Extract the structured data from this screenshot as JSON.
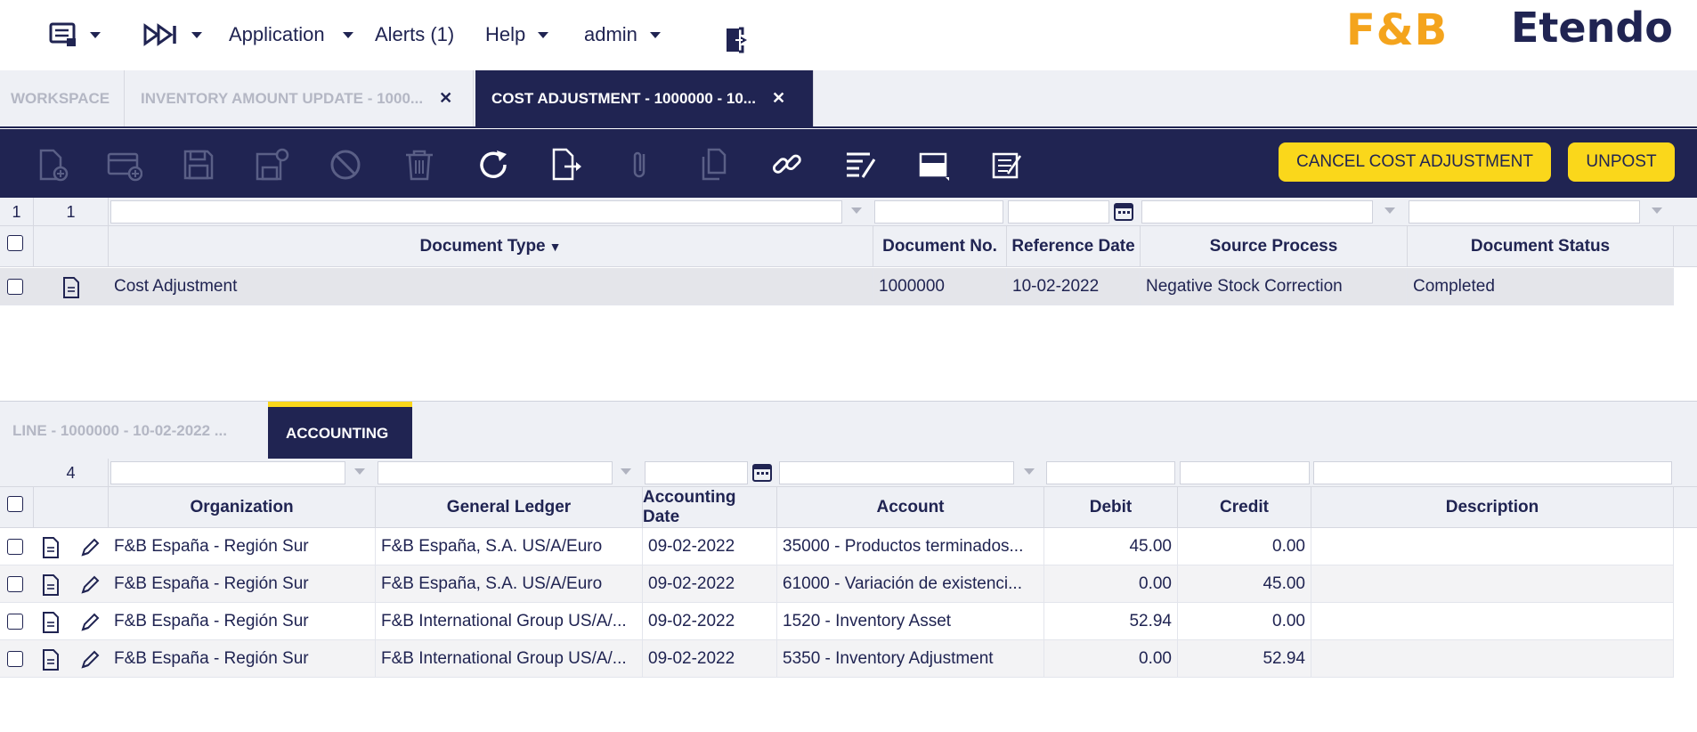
{
  "topbar": {
    "nav": {
      "application": "Application",
      "alerts": "Alerts (1)",
      "help": "Help",
      "user": "admin"
    },
    "brand_logo": "F&B",
    "brand_name": "Etendo"
  },
  "window_tabs": [
    {
      "label": "WORKSPACE"
    },
    {
      "label": "INVENTORY AMOUNT UPDATE - 1000..."
    },
    {
      "label": "COST ADJUSTMENT - 1000000 - 10..."
    }
  ],
  "toolbar": {
    "cancel_label": "CANCEL COST ADJUSTMENT",
    "unpost_label": "UNPOST",
    "icons": [
      "new-document-icon",
      "new-row-icon",
      "save-icon",
      "save-close-icon",
      "undo-icon",
      "delete-icon",
      "refresh-icon",
      "export-icon",
      "attachment-icon",
      "clone-icon",
      "link-icon",
      "audit-icon",
      "grid-view-icon",
      "notes-icon"
    ]
  },
  "header_grid": {
    "selected_count": "1",
    "total_count": "1",
    "columns": [
      "Document Type",
      "Document No.",
      "Reference Date",
      "Source Process",
      "Document Status"
    ],
    "rows": [
      {
        "document_type": "Cost Adjustment",
        "document_no": "1000000",
        "reference_date": "10-02-2022",
        "source_process": "Negative Stock Correction",
        "document_status": "Completed"
      }
    ]
  },
  "child_tabs": [
    {
      "label": "LINE - 1000000 - 10-02-2022 ..."
    },
    {
      "label": "ACCOUNTING"
    }
  ],
  "accounting_grid": {
    "total_count": "4",
    "columns": [
      "Organization",
      "General Ledger",
      "Accounting Date",
      "Account",
      "Debit",
      "Credit",
      "Description"
    ],
    "rows": [
      {
        "organization": "F&B España - Región Sur",
        "ledger": "F&B España, S.A. US/A/Euro",
        "date": "09-02-2022",
        "account": "35000 - Productos terminados...",
        "debit": "45.00",
        "credit": "0.00",
        "description": ""
      },
      {
        "organization": "F&B España - Región Sur",
        "ledger": "F&B España, S.A. US/A/Euro",
        "date": "09-02-2022",
        "account": "61000 - Variación de existenci...",
        "debit": "0.00",
        "credit": "45.00",
        "description": ""
      },
      {
        "organization": "F&B España - Región Sur",
        "ledger": "F&B International Group US/A/...",
        "date": "09-02-2022",
        "account": "1520 - Inventory Asset",
        "debit": "52.94",
        "credit": "0.00",
        "description": ""
      },
      {
        "organization": "F&B España - Región Sur",
        "ledger": "F&B International Group US/A/...",
        "date": "09-02-2022",
        "account": "5350 - Inventory Adjustment",
        "debit": "0.00",
        "credit": "52.94",
        "description": ""
      }
    ]
  },
  "colors": {
    "primary": "#202452",
    "accent": "#fad71b",
    "brand_orange": "#f4a41d",
    "surface": "#eef0f5"
  }
}
